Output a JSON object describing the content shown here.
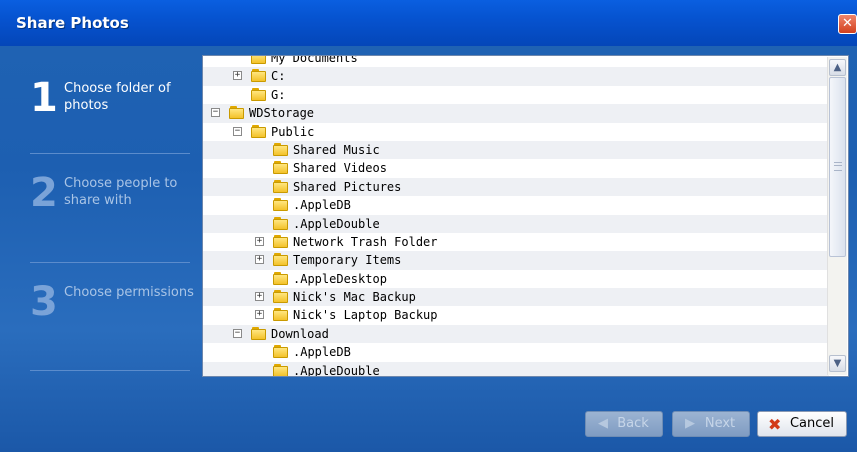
{
  "window": {
    "title": "Share Photos",
    "close_glyph": "✕"
  },
  "steps": [
    {
      "number": "1",
      "label": "Choose folder of photos",
      "active": true
    },
    {
      "number": "2",
      "label": "Choose people to share with",
      "active": false
    },
    {
      "number": "3",
      "label": "Choose permissions",
      "active": false
    }
  ],
  "tree": {
    "rows": [
      {
        "name": "My Documents",
        "level": 1,
        "expander": ""
      },
      {
        "name": "C:",
        "level": 1,
        "expander": "+"
      },
      {
        "name": "G:",
        "level": 1,
        "expander": ""
      },
      {
        "name": "WDStorage",
        "level": 0,
        "expander": "-"
      },
      {
        "name": "Public",
        "level": 1,
        "expander": "-"
      },
      {
        "name": "Shared Music",
        "level": 2,
        "expander": ""
      },
      {
        "name": "Shared Videos",
        "level": 2,
        "expander": ""
      },
      {
        "name": "Shared Pictures",
        "level": 2,
        "expander": ""
      },
      {
        "name": ".AppleDB",
        "level": 2,
        "expander": ""
      },
      {
        "name": ".AppleDouble",
        "level": 2,
        "expander": ""
      },
      {
        "name": "Network Trash Folder",
        "level": 2,
        "expander": "+"
      },
      {
        "name": "Temporary Items",
        "level": 2,
        "expander": "+"
      },
      {
        "name": ".AppleDesktop",
        "level": 2,
        "expander": ""
      },
      {
        "name": "Nick's Mac Backup",
        "level": 2,
        "expander": "+"
      },
      {
        "name": "Nick's Laptop Backup",
        "level": 2,
        "expander": "+"
      },
      {
        "name": "Download",
        "level": 1,
        "expander": "-"
      },
      {
        "name": ".AppleDB",
        "level": 2,
        "expander": ""
      },
      {
        "name": ".AppleDouble",
        "level": 2,
        "expander": ""
      }
    ]
  },
  "scrollbar": {
    "up_glyph": "▲",
    "down_glyph": "▼"
  },
  "buttons": {
    "back": "Back",
    "next": "Next",
    "cancel": "Cancel"
  },
  "icons": {
    "folder": "folder-icon",
    "back_arrow": "◀",
    "next_arrow": "▶",
    "cancel_x": "✖"
  }
}
